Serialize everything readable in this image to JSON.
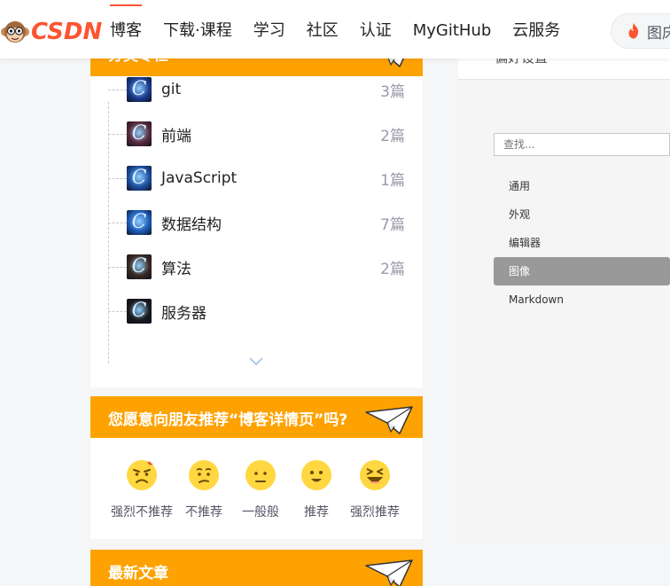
{
  "header": {
    "logo_text": "CSDN",
    "nav": [
      "博客",
      "下载·课程",
      "学习",
      "社区",
      "认证",
      "MyGitHub",
      "云服务"
    ],
    "active_nav": 0,
    "hot_search_label": "图床",
    "brand_color": "#fc5531"
  },
  "categories": {
    "title": "分类专栏",
    "items": [
      {
        "name": "git",
        "count": "3篇",
        "thumb_color": "#1b3a8c"
      },
      {
        "name": "前端",
        "count": "2篇",
        "thumb_color": "#5a2a3a"
      },
      {
        "name": "JavaScript",
        "count": "1篇",
        "thumb_color": "#1d4fa0"
      },
      {
        "name": "数据结构",
        "count": "7篇",
        "thumb_color": "#1e5cb8"
      },
      {
        "name": "算法",
        "count": "2篇",
        "thumb_color": "#3a2a20"
      },
      {
        "name": "服务器",
        "count": "",
        "thumb_color": "#1a1a1a"
      }
    ],
    "expand_icon": "chevron-down-icon"
  },
  "recommend": {
    "title": "您愿意向朋友推荐“博客详情页”吗?",
    "options": [
      {
        "label": "强烈不推荐",
        "mood": "angry"
      },
      {
        "label": "不推荐",
        "mood": "unhappy"
      },
      {
        "label": "一般般",
        "mood": "neutral"
      },
      {
        "label": "推荐",
        "mood": "happy"
      },
      {
        "label": "强烈推荐",
        "mood": "delighted"
      }
    ]
  },
  "latest": {
    "title": "最新文章"
  },
  "preferences": {
    "title": "偏好设置",
    "search_placeholder": "查找...",
    "menu": [
      "通用",
      "外观",
      "编辑器",
      "图像",
      "Markdown"
    ],
    "selected": 3
  },
  "colors": {
    "accent_orange": "#fea202",
    "selected_gray": "#999999"
  }
}
